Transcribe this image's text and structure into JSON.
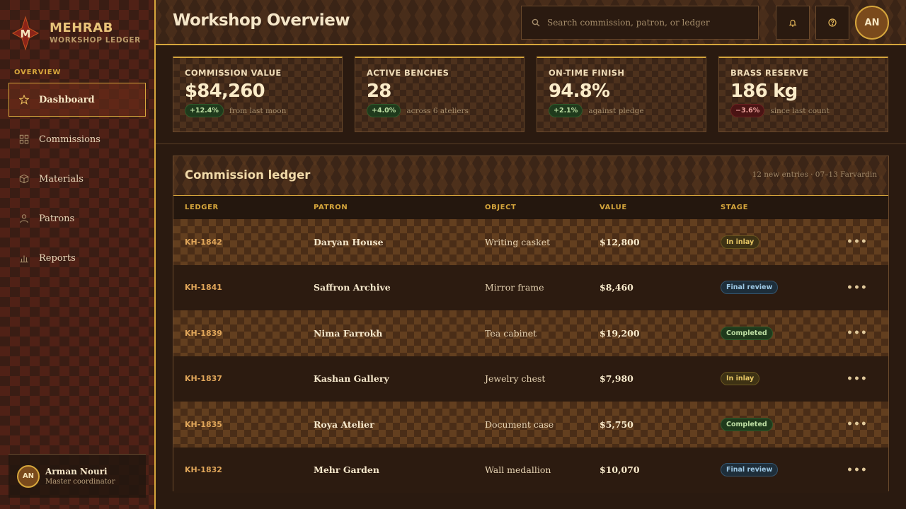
{
  "brand": {
    "mark": "M",
    "name": "MEHRAB",
    "sub": "WORKSHOP LEDGER"
  },
  "sidebar": {
    "section": "OVERVIEW",
    "items": [
      {
        "label": "Dashboard",
        "icon": "star-icon",
        "active": true
      },
      {
        "label": "Commissions",
        "icon": "grid-icon"
      },
      {
        "label": "Materials",
        "icon": "box-icon"
      },
      {
        "label": "Patrons",
        "icon": "user-icon"
      },
      {
        "label": "Reports",
        "icon": "bar-chart-icon"
      }
    ],
    "user": {
      "initials": "AN",
      "name": "Arman Nouri",
      "role": "Master coordinator"
    }
  },
  "header": {
    "title": "Workshop Overview",
    "search_placeholder": "Search commission, patron, or ledger",
    "avatar": "AN"
  },
  "stats": [
    {
      "label": "COMMISSION VALUE",
      "value": "$84,260",
      "delta": "+12.4%",
      "trend": "up",
      "note": "from last moon"
    },
    {
      "label": "ACTIVE BENCHES",
      "value": "28",
      "delta": "+4.0%",
      "trend": "up",
      "note": "across 6 ateliers"
    },
    {
      "label": "ON-TIME FINISH",
      "value": "94.8%",
      "delta": "+2.1%",
      "trend": "up",
      "note": "against pledge"
    },
    {
      "label": "BRASS RESERVE",
      "value": "186 kg",
      "delta": "−3.6%",
      "trend": "down",
      "note": "since last count"
    }
  ],
  "ledger": {
    "title": "Commission ledger",
    "meta": "12 new entries · 07–13 Farvardin",
    "columns": [
      "LEDGER",
      "PATRON",
      "OBJECT",
      "VALUE",
      "STAGE",
      ""
    ],
    "rows": [
      {
        "id": "KH-1842",
        "patron": "Daryan House",
        "object": "Writing casket",
        "value": "$12,800",
        "stage": "In inlay",
        "stage_kind": "inlay"
      },
      {
        "id": "KH-1841",
        "patron": "Saffron Archive",
        "object": "Mirror frame",
        "value": "$8,460",
        "stage": "Final review",
        "stage_kind": "review"
      },
      {
        "id": "KH-1839",
        "patron": "Nima Farrokh",
        "object": "Tea cabinet",
        "value": "$19,200",
        "stage": "Completed",
        "stage_kind": "done"
      },
      {
        "id": "KH-1837",
        "patron": "Kashan Gallery",
        "object": "Jewelry chest",
        "value": "$7,980",
        "stage": "In inlay",
        "stage_kind": "inlay"
      },
      {
        "id": "KH-1835",
        "patron": "Roya Atelier",
        "object": "Document case",
        "value": "$5,750",
        "stage": "Completed",
        "stage_kind": "done"
      },
      {
        "id": "KH-1832",
        "patron": "Mehr Garden",
        "object": "Wall medallion",
        "value": "$10,070",
        "stage": "Final review",
        "stage_kind": "review"
      }
    ],
    "row_action": "•••"
  },
  "colors": {
    "accent": "#d6a63c",
    "brand_red": "#8a2418",
    "positive": "#bfe0a4",
    "negative": "#f0a6a0"
  }
}
